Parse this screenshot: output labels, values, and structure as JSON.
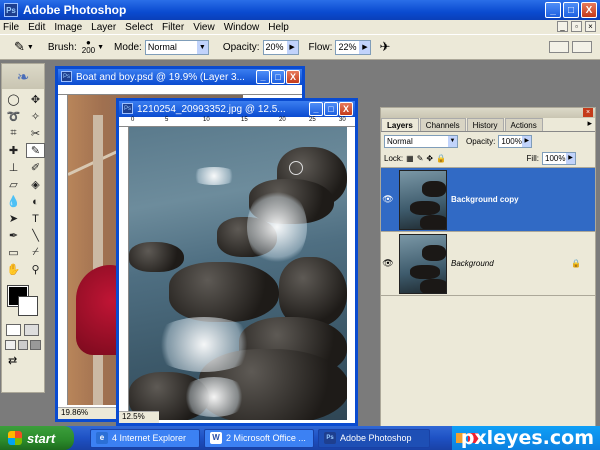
{
  "app": {
    "title": "Adobe Photoshop",
    "logo_text": "Ps",
    "window_controls": [
      "_",
      "□",
      "X"
    ]
  },
  "menubar": {
    "items": [
      "File",
      "Edit",
      "Image",
      "Layer",
      "Select",
      "Filter",
      "View",
      "Window",
      "Help"
    ]
  },
  "options_bar": {
    "brush_label": "Brush:",
    "brush_size": "200",
    "mode_label": "Mode:",
    "mode_value": "Normal",
    "opacity_label": "Opacity:",
    "opacity_value": "20%",
    "flow_label": "Flow:",
    "flow_value": "22%"
  },
  "toolbox": {
    "tools": [
      "marquee-icon",
      "move-icon",
      "lasso-icon",
      "magic-wand-icon",
      "crop-icon",
      "slice-icon",
      "healing-icon",
      "brush-icon",
      "stamp-icon",
      "history-brush-icon",
      "eraser-icon",
      "bucket-icon",
      "blur-icon",
      "dodge-icon",
      "path-select-icon",
      "type-icon",
      "pen-icon",
      "line-icon",
      "notes-icon",
      "eyedropper-icon",
      "hand-icon",
      "zoom-icon"
    ],
    "active_tool": "brush-icon",
    "foreground_color": "#000000",
    "background_color": "#ffffff"
  },
  "doc_boat": {
    "title": "Boat and boy.psd @ 19.9% (Layer 3...",
    "zoom": "19.86%"
  },
  "doc_rocks": {
    "title": "1210254_20993352.jpg @ 12.5...",
    "zoom": "12.5%",
    "ruler_marks": [
      "0",
      "5",
      "10",
      "15",
      "20",
      "25",
      "30"
    ]
  },
  "layers_panel": {
    "tabs": [
      "Layers",
      "Channels",
      "History",
      "Actions"
    ],
    "active_tab": "Layers",
    "blend_mode": "Normal",
    "opacity_label": "Opacity:",
    "opacity_value": "100%",
    "lock_label": "Lock:",
    "fill_label": "Fill:",
    "fill_value": "100%",
    "layers": [
      {
        "name": "Background copy",
        "selected": true,
        "locked": false
      },
      {
        "name": "Background",
        "selected": false,
        "locked": true
      }
    ]
  },
  "taskbar": {
    "start_label": "start",
    "tasks": [
      {
        "label": "4 Internet Explorer",
        "icon": "e"
      },
      {
        "label": "2 Microsoft Office ...",
        "icon": "W"
      },
      {
        "label": "Adobe Photoshop",
        "icon": "Ps"
      }
    ],
    "watermark": "pxleyes.com"
  }
}
